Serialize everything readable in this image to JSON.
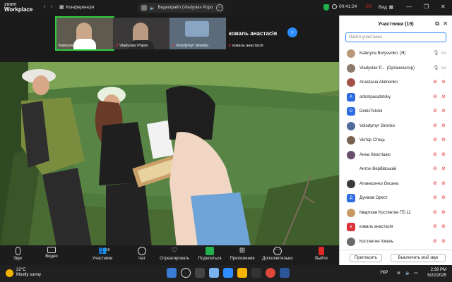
{
  "app": {
    "logo_line1": "zoom",
    "logo_line2": "Workplace",
    "conference_label": "Конференція",
    "sharing_label": "Видеофайл (Vladyslav Popo",
    "timer": "00:41:24",
    "lang": "EN",
    "view_label": "Вид"
  },
  "thumbnails": [
    {
      "name": "Kateryna Borysenko",
      "active": true
    },
    {
      "name": "Vladyslav Popov"
    },
    {
      "name": "Volodymyr Sirenko"
    }
  ],
  "name_tile": {
    "big": "коваль анастасія",
    "small": "коваль анастасія"
  },
  "toolbar": {
    "audio": "Звук",
    "video": "Видео",
    "participants": "Участники",
    "participants_count": "19",
    "chat": "Чат",
    "react": "Отреагировать",
    "share": "Поделиться",
    "apps": "Приложения",
    "more": "Дополнительно",
    "leave": "Выйти"
  },
  "panel": {
    "title": "Участники (19)",
    "search_placeholder": "Найти участника",
    "invite": "Пригласить",
    "mute_me": "Выключить мой звук",
    "participants": [
      {
        "name": "Kateryna Borysenko",
        "suffix": "(Я)",
        "avatar": "photo",
        "color": "#b89a7a",
        "mic": "on",
        "cam": "on"
      },
      {
        "name": "Vladyslav P...",
        "suffix": "(Организатор)",
        "tag": "",
        "avatar": "photo",
        "color": "#8d7a6a",
        "mic": "on",
        "cam": "on"
      },
      {
        "name": "Anastasia Akimenko",
        "avatar": "photo",
        "color": "#a4524a",
        "mic": "off",
        "cam": "off"
      },
      {
        "name": "artempasatetsky",
        "avatar": "A",
        "color": "#2d6be0",
        "mic": "off",
        "cam": "off"
      },
      {
        "name": "DenisTolstoi",
        "avatar": "D",
        "color": "#2d6be0",
        "mic": "off",
        "cam": "off"
      },
      {
        "name": "Volodymyr Sirenko",
        "avatar": "photo",
        "color": "#4e6b9a",
        "mic": "off",
        "cam": "off"
      },
      {
        "name": "Viктор Стець",
        "avatar": "photo",
        "color": "#7a6250",
        "mic": "off",
        "cam": "off"
      },
      {
        "name": "Анна Хвостішко",
        "avatar": "photo",
        "color": "#6a4e6e",
        "mic": "off",
        "cam": "off"
      },
      {
        "name": "Антон Вербівський",
        "avatar": "none",
        "color": "#ffffff",
        "mic": "off",
        "cam": "off"
      },
      {
        "name": "Апанасенко Оксана",
        "avatar": "photo",
        "color": "#3a3a3a",
        "mic": "off",
        "cam": "off"
      },
      {
        "name": "Дуніков Орест",
        "avatar": "Д",
        "color": "#2d6be0",
        "mic": "off",
        "cam": "off"
      },
      {
        "name": "Кварткин Костянтин ГЕ-11",
        "avatar": "photo",
        "color": "#c79a64",
        "mic": "off",
        "cam": "off"
      },
      {
        "name": "коваль анастасія",
        "avatar": "к",
        "color": "#d9323a",
        "mic": "off",
        "cam": "off"
      },
      {
        "name": "Костянтин Хмель",
        "avatar": "photo",
        "color": "#6a6a6a",
        "mic": "off",
        "cam": "off"
      }
    ]
  },
  "taskbar": {
    "temp": "22°C",
    "weather": "Mostly sunny",
    "search": "Search",
    "lang": "УКР",
    "time": "2:39 PM",
    "date": "5/22/2025"
  }
}
